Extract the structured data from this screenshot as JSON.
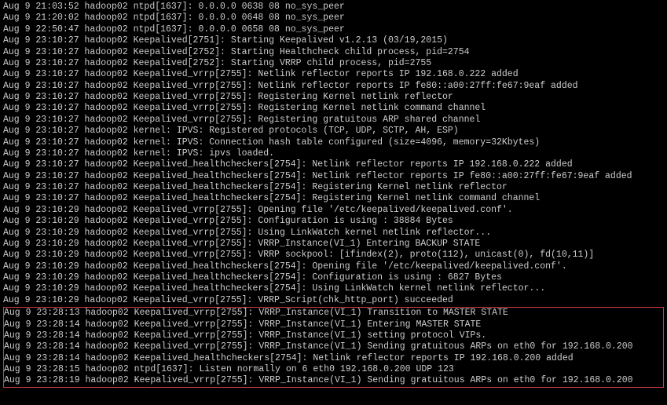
{
  "lines_top": [
    "Aug  9 21:03:52 hadoop02 ntpd[1637]: 0.0.0.0 0638 08 no_sys_peer",
    "Aug  9 21:20:02 hadoop02 ntpd[1637]: 0.0.0.0 0648 08 no_sys_peer",
    "Aug  9 22:50:47 hadoop02 ntpd[1637]: 0.0.0.0 0658 08 no_sys_peer",
    "Aug  9 23:10:27 hadoop02 Keepalived[2751]: Starting Keepalived v1.2.13 (03/19,2015)",
    "Aug  9 23:10:27 hadoop02 Keepalived[2752]: Starting Healthcheck child process, pid=2754",
    "Aug  9 23:10:27 hadoop02 Keepalived[2752]: Starting VRRP child process, pid=2755",
    "Aug  9 23:10:27 hadoop02 Keepalived_vrrp[2755]: Netlink reflector reports IP 192.168.0.222 added",
    "Aug  9 23:10:27 hadoop02 Keepalived_vrrp[2755]: Netlink reflector reports IP fe80::a00:27ff:fe67:9eaf added",
    "Aug  9 23:10:27 hadoop02 Keepalived_vrrp[2755]: Registering Kernel netlink reflector",
    "Aug  9 23:10:27 hadoop02 Keepalived_vrrp[2755]: Registering Kernel netlink command channel",
    "Aug  9 23:10:27 hadoop02 Keepalived_vrrp[2755]: Registering gratuitous ARP shared channel",
    "Aug  9 23:10:27 hadoop02 kernel: IPVS: Registered protocols (TCP, UDP, SCTP, AH, ESP)",
    "Aug  9 23:10:27 hadoop02 kernel: IPVS: Connection hash table configured (size=4096, memory=32Kbytes)",
    "Aug  9 23:10:27 hadoop02 kernel: IPVS: ipvs loaded.",
    "Aug  9 23:10:27 hadoop02 Keepalived_healthcheckers[2754]: Netlink reflector reports IP 192.168.0.222 added",
    "Aug  9 23:10:27 hadoop02 Keepalived_healthcheckers[2754]: Netlink reflector reports IP fe80::a00:27ff:fe67:9eaf added",
    "Aug  9 23:10:27 hadoop02 Keepalived_healthcheckers[2754]: Registering Kernel netlink reflector",
    "Aug  9 23:10:27 hadoop02 Keepalived_healthcheckers[2754]: Registering Kernel netlink command channel",
    "Aug  9 23:10:29 hadoop02 Keepalived_vrrp[2755]: Opening file '/etc/keepalived/keepalived.conf'.",
    "Aug  9 23:10:29 hadoop02 Keepalived_vrrp[2755]: Configuration is using : 38884 Bytes",
    "Aug  9 23:10:29 hadoop02 Keepalived_vrrp[2755]: Using LinkWatch kernel netlink reflector...",
    "Aug  9 23:10:29 hadoop02 Keepalived_vrrp[2755]: VRRP_Instance(VI_1) Entering BACKUP STATE",
    "Aug  9 23:10:29 hadoop02 Keepalived_vrrp[2755]: VRRP sockpool: [ifindex(2), proto(112), unicast(0), fd(10,11)]",
    "Aug  9 23:10:29 hadoop02 Keepalived_healthcheckers[2754]: Opening file '/etc/keepalived/keepalived.conf'.",
    "Aug  9 23:10:29 hadoop02 Keepalived_healthcheckers[2754]: Configuration is using : 6827 Bytes",
    "Aug  9 23:10:29 hadoop02 Keepalived_healthcheckers[2754]: Using LinkWatch kernel netlink reflector...",
    "Aug  9 23:10:29 hadoop02 Keepalived_vrrp[2755]: VRRP_Script(chk_http_port) succeeded"
  ],
  "lines_highlight": [
    "Aug  9 23:28:13 hadoop02 Keepalived_vrrp[2755]: VRRP_Instance(VI_1) Transition to MASTER STATE",
    "Aug  9 23:28:14 hadoop02 Keepalived_vrrp[2755]: VRRP_Instance(VI_1) Entering MASTER STATE",
    "Aug  9 23:28:14 hadoop02 Keepalived_vrrp[2755]: VRRP_Instance(VI_1) setting protocol VIPs.",
    "Aug  9 23:28:14 hadoop02 Keepalived_vrrp[2755]: VRRP_Instance(VI_1) Sending gratuitous ARPs on eth0 for 192.168.0.200",
    "Aug  9 23:28:14 hadoop02 Keepalived_healthcheckers[2754]: Netlink reflector reports IP 192.168.0.200 added",
    "Aug  9 23:28:15 hadoop02 ntpd[1637]: Listen normally on 6 eth0 192.168.0.200 UDP 123",
    "Aug  9 23:28:19 hadoop02 Keepalived_vrrp[2755]: VRRP_Instance(VI_1) Sending gratuitous ARPs on eth0 for 192.168.0.200"
  ]
}
